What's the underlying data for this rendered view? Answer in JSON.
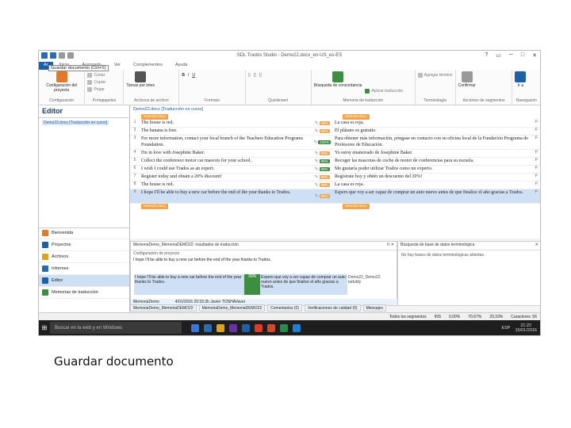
{
  "window": {
    "title": "SDL Trados Studio - Demo22.docx_en-US_es-ES",
    "tooltip": "Guardar documento (Ctrl+S)",
    "controls": [
      "?",
      "▭",
      "─",
      "□",
      "✕"
    ]
  },
  "ribbon": {
    "file_tab": "Ar",
    "tabs": [
      "Inicio",
      "Avanzado",
      "Ver",
      "Complementos",
      "Ayuda"
    ],
    "groups": [
      {
        "label": "Configuración",
        "big": "Configuración del proyecto",
        "color": "#e07a2b"
      },
      {
        "label": "Portapapeles",
        "small": [
          "Cortar",
          "Copiar",
          "Pegar"
        ]
      },
      {
        "label": "Archivos de archivo",
        "big": "Tareas por lotes",
        "color": "#555555"
      },
      {
        "label": "Formato",
        "small": [
          "B",
          "I",
          "U"
        ]
      },
      {
        "label": "Quickinsert",
        "small": [
          "()",
          "[]",
          "{}"
        ]
      },
      {
        "label": "Memoria de traducción",
        "big": "Búsqueda de concordancia",
        "color": "#3e8e41",
        "small": [
          "Aplicar traducción"
        ]
      },
      {
        "label": "Terminología",
        "small": [
          "Agregar término"
        ]
      },
      {
        "label": "Acciones de segmentos",
        "big": "Confirmar",
        "color": "#999999"
      },
      {
        "label": "Navegación",
        "big": "Ir a",
        "color": "#1f5fa8"
      }
    ]
  },
  "left_pane": {
    "title": "Editor",
    "tree_item": "Demo22.docx [Traducción en curso]",
    "nav": [
      {
        "label": "Bienvenida",
        "color": "#e07a2b"
      },
      {
        "label": "Proyectos",
        "color": "#1f5fa8"
      },
      {
        "label": "Archivos",
        "color": "#d9a520"
      },
      {
        "label": "Informes",
        "color": "#2b6cb0"
      },
      {
        "label": "Editor",
        "color": "#1f5fa8",
        "active": true
      },
      {
        "label": "Memorias de traducción",
        "color": "#3e8e41"
      }
    ]
  },
  "editor": {
    "doc_tab": "Demo22.docx [Traducción en curso]",
    "start_tag": "Demo22.docx",
    "end_tag": "Demo22.docx",
    "segments": [
      {
        "n": "1",
        "src": "The house is red.",
        "pct": "99%",
        "pct_color": "#f2a44a",
        "tgt": "La casa es roja.",
        "flag": "F"
      },
      {
        "n": "2",
        "src": "The banana is free.",
        "pct": "99%",
        "pct_color": "#f2a44a",
        "tgt": "El plátano es gratuito.",
        "flag": "F"
      },
      {
        "n": "3",
        "src": "For more information, contact your local branch of the Teachers Education Programs Foundation.",
        "pct": "100%",
        "pct_color": "#3e8e41",
        "tgt": "Para obtener más información, póngase en contacto con su oficina local de la Fundación Programa de Profesores de Educación.",
        "flag": "F",
        "tall": true
      },
      {
        "n": "4",
        "src": "I'm in love with Josephine Baker.",
        "pct": "99%",
        "pct_color": "#f2a44a",
        "tgt": "Yo estoy enamorado de Josephine Baker.",
        "flag": "F"
      },
      {
        "n": "5",
        "src": "Collect the conference motor car mascots for your school.",
        "pct": "99%",
        "pct_color": "#3e8e41",
        "tgt": "Recoger las mascotas de coche de motor de conferencias para su escuela.",
        "flag": "F"
      },
      {
        "n": "6",
        "src": "I wish I could use Trados as an expert.",
        "pct": "99%",
        "pct_color": "#3e8e41",
        "tgt": "Me gustaría poder utilizar Trados como un experto.",
        "flag": "F"
      },
      {
        "n": "7",
        "src": "Register today and obtain a 20% discount!",
        "pct": "99%",
        "pct_color": "#f2a44a",
        "tgt": "Regístrate hoy y obtén un descuento del 20%!",
        "flag": "F"
      },
      {
        "n": "8",
        "src": "The house is red.",
        "pct": "99%",
        "pct_color": "#f2a44a",
        "tgt": "La casa es roja.",
        "flag": "F"
      },
      {
        "n": "9",
        "src": "I hope I'll be able to buy a new car before the end of the year thanks to Trados.",
        "pct": "99%",
        "pct_color": "#f2a44a",
        "tgt": "Espero que voy a ser capaz de comprar un auto nuevo antes de que finalice el año gracias a Trados.",
        "flag": "F",
        "tall": true,
        "selected": true
      }
    ]
  },
  "tm_panel": {
    "title": "MemoriaDemo_MemoriaDEMO22: resultados de traducción",
    "config_link": "Configuración de proyecto",
    "query": "I hope I'll be able to buy a new car before the end of the year thanks to Trados.",
    "hit_source": "I hope I'll be able to buy a new car before the end of the year thanks to Trados.",
    "hit_pct": "99%",
    "hit_target": "Espero que voy a ser capaz de comprar un auto nuevo antes de que finalice el año gracias a Trados.",
    "hit_meta": "Demo22_Demo22 taduldy",
    "foot_name": "MemoriaDemo",
    "foot_info": "4/01/2016 20:33:3h Javier TOSHAVaver"
  },
  "term_panel": {
    "title": "Búsqueda de base de datos terminológica",
    "message": "No hay bases de datos terminológicas abiertas."
  },
  "bottom_tabs": [
    "MemoriaDemo_MemoriaDEMO22",
    "MemoriaDemo_MemoriaDEMO22",
    "Comentarios (0)",
    "Verificaciones de calidad (0)",
    "Mensajes"
  ],
  "status": {
    "filter": "Todos los segmentos",
    "mode": "INS",
    "p1": "0,00%",
    "p2": "70,67%",
    "p3": "29,33%",
    "chars": "Caracteres: 56"
  },
  "taskbar": {
    "search": "Buscar en la web y en Windows",
    "lang": "ESP",
    "time": "21:22",
    "date": "15/01/2016",
    "icon_colors": [
      "#3b78d6",
      "#2b6cb0",
      "#d9a520",
      "#6b2fa8",
      "#1f5fa8",
      "#e03a2b",
      "#d04a2b",
      "#2b8a4a",
      "#1f7fd0"
    ]
  },
  "caption": "Guardar documento"
}
